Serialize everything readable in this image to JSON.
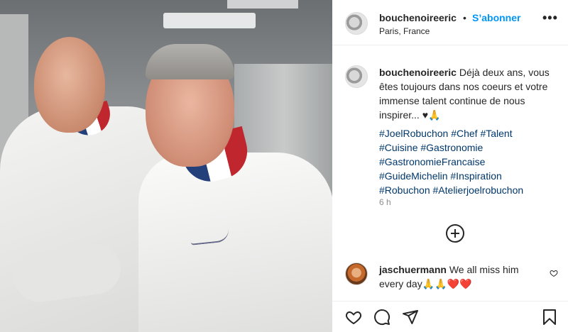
{
  "post": {
    "author": "bouchenoireeric",
    "separator": "•",
    "follow_label": "S’abonner",
    "location": "Paris, France",
    "more_label": "•••"
  },
  "caption": {
    "author": "bouchenoireeric",
    "text": "Déjà deux ans, vous êtes toujours dans nos coeurs et votre immense talent continue de nous inspirer... ♥🙏",
    "hashtags": [
      "#JoelRobuchon",
      "#Chef",
      "#Talent",
      "#Cuisine",
      "#Gastronomie",
      "#GastronomieFrancaise",
      "#GuideMichelin",
      "#Inspiration",
      "#Robuchon",
      "#Atelierjoelrobuchon"
    ],
    "timestamp": "6 h"
  },
  "comments": [
    {
      "author": "jaschuermann",
      "text": "We all miss him every day🙏🙏❤️❤️"
    }
  ],
  "icons": {
    "like": "heart-icon",
    "comment": "comment-bubble-icon",
    "share": "paper-plane-icon",
    "save": "bookmark-icon",
    "load_more": "plus-circle-icon"
  },
  "colors": {
    "accent": "#0095f6",
    "hashtag": "#00376b",
    "muted": "#8e8e8e",
    "text": "#262626"
  }
}
